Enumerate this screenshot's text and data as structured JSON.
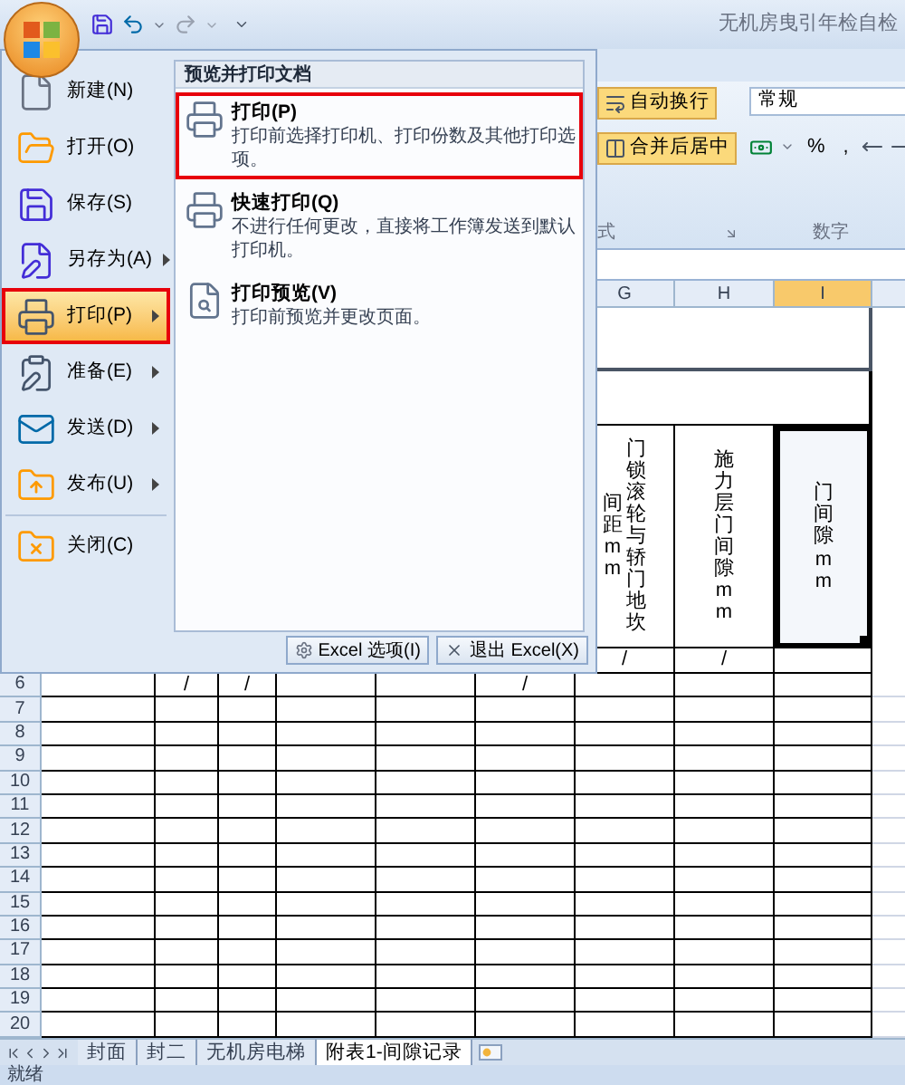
{
  "title_bar": {
    "title": "无机房曳引年检自检"
  },
  "ribbon": {
    "buttons": [
      {
        "label": "自动换行",
        "active": true
      },
      {
        "label": "合并后居中",
        "active": true
      }
    ],
    "number_format": {
      "value": "常规"
    },
    "number_buttons": [
      "%",
      ","
    ],
    "groups": [
      "式",
      "数字"
    ]
  },
  "sheet": {
    "columns": [
      {
        "label": "G",
        "selected": false
      },
      {
        "label": "H",
        "selected": false
      },
      {
        "label": "I",
        "selected": true
      }
    ],
    "header": [
      {
        "text_columns": [
          "间距mm",
          "门锁滚轮与轿门地坎"
        ],
        "selected": false
      },
      {
        "text_columns": [
          "施力层门间隙mm"
        ],
        "selected": false
      },
      {
        "text_columns": [
          "门间隙mm"
        ],
        "selected": true
      }
    ],
    "partial_row": {
      "cells": [
        "/",
        "/",
        null
      ]
    },
    "rows": [
      {
        "number": "6",
        "cells": [
          null,
          "/",
          "/",
          null,
          null,
          "/",
          null,
          null,
          null
        ]
      },
      {
        "number": "7"
      },
      {
        "number": "8"
      },
      {
        "number": "9"
      },
      {
        "number": "10"
      },
      {
        "number": "11"
      },
      {
        "number": "12"
      },
      {
        "number": "13"
      },
      {
        "number": "14"
      },
      {
        "number": "15"
      },
      {
        "number": "16"
      },
      {
        "number": "17"
      },
      {
        "number": "18"
      },
      {
        "number": "19"
      },
      {
        "number": "20"
      }
    ]
  },
  "sheet_tabs": [
    {
      "label": "封面",
      "selected": false
    },
    {
      "label": "封二",
      "selected": false
    },
    {
      "label": "无机房电梯",
      "selected": false
    },
    {
      "label": "附表1-间隙记录",
      "selected": true
    }
  ],
  "status_bar": {
    "text": "就绪"
  },
  "menu": {
    "left_items": [
      {
        "label": "新建(N)",
        "submenu": false,
        "selected": false,
        "annotated": false
      },
      {
        "label": "打开(O)",
        "submenu": false,
        "selected": false,
        "annotated": false
      },
      {
        "label": "保存(S)",
        "submenu": false,
        "selected": false,
        "annotated": false
      },
      {
        "label": "另存为(A)",
        "submenu": true,
        "selected": false,
        "annotated": false
      },
      {
        "label": "打印(P)",
        "submenu": true,
        "selected": true,
        "annotated": true
      },
      {
        "label": "准备(E)",
        "submenu": true,
        "selected": false,
        "annotated": false
      },
      {
        "label": "发送(D)",
        "submenu": true,
        "selected": false,
        "annotated": false
      },
      {
        "label": "发布(U)",
        "submenu": true,
        "selected": false,
        "annotated": false
      },
      {
        "label": "关闭(C)",
        "submenu": false,
        "selected": false,
        "annotated": false
      }
    ],
    "panel_title": "预览并打印文档",
    "panel_items": [
      {
        "title": "打印(P)",
        "description": "打印前选择打印机、打印份数及其他打印选项。",
        "annotated": true
      },
      {
        "title": "快速打印(Q)",
        "description": "不进行任何更改，直接将工作簿发送到默认打印机。",
        "annotated": false
      },
      {
        "title": "打印预览(V)",
        "description": "打印前预览并更改页面。",
        "annotated": false
      }
    ],
    "footer_buttons": [
      "Excel 选项(I)",
      "退出 Excel(X)"
    ]
  }
}
